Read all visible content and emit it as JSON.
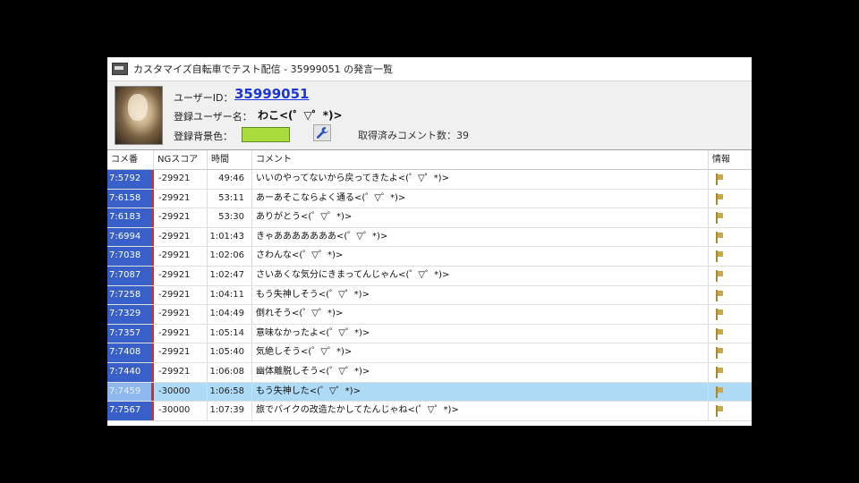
{
  "window": {
    "title": "カスタマイズ自転車でテスト配信 - 35999051 の発言一覧"
  },
  "user": {
    "id_label": "ユーザーID：",
    "id_value": "35999051",
    "name_label": "登録ユーザー名：",
    "name_value": "わこ<(゜▽゜*)>",
    "bg_label": "登録背景色：",
    "bg_color": "#a8dc3c",
    "count_label": "取得済みコメント数：",
    "count_value": "39"
  },
  "table": {
    "headers": [
      "コメ番",
      "NGスコア",
      "時間",
      "コメント",
      "情報"
    ],
    "rows": [
      {
        "no": "7:5792",
        "ng": "-29921",
        "time": "49:46",
        "comment": "いいのやってないから戻ってきたよ<(゜▽゜*)>"
      },
      {
        "no": "7:6158",
        "ng": "-29921",
        "time": "53:11",
        "comment": "あーあそこならよく通る<(゜▽゜*)>"
      },
      {
        "no": "7:6183",
        "ng": "-29921",
        "time": "53:30",
        "comment": "ありがとう<(゜▽゜*)>"
      },
      {
        "no": "7:6994",
        "ng": "-29921",
        "time": "1:01:43",
        "comment": "きゃあああああああ<(゜▽゜*)>"
      },
      {
        "no": "7:7038",
        "ng": "-29921",
        "time": "1:02:06",
        "comment": "さわんな<(゜▽゜*)>"
      },
      {
        "no": "7:7087",
        "ng": "-29921",
        "time": "1:02:47",
        "comment": "さいあくな気分にきまってんじゃん<(゜▽゜*)>"
      },
      {
        "no": "7:7258",
        "ng": "-29921",
        "time": "1:04:11",
        "comment": "もう失神しそう<(゜▽゜*)>"
      },
      {
        "no": "7:7329",
        "ng": "-29921",
        "time": "1:04:49",
        "comment": "倒れそう<(゜▽゜*)>"
      },
      {
        "no": "7:7357",
        "ng": "-29921",
        "time": "1:05:14",
        "comment": "意味なかったよ<(゜▽゜*)>"
      },
      {
        "no": "7:7408",
        "ng": "-29921",
        "time": "1:05:40",
        "comment": "気絶しそう<(゜▽゜*)>"
      },
      {
        "no": "7:7440",
        "ng": "-29921",
        "time": "1:06:08",
        "comment": "幽体離脱しそう<(゜▽゜*)>"
      },
      {
        "no": "7:7459",
        "ng": "-30000",
        "time": "1:06:58",
        "comment": "もう失神した<(゜▽゜*)>",
        "selected": true
      },
      {
        "no": "7:7567",
        "ng": "-30000",
        "time": "1:07:39",
        "comment": "旅でバイクの改造たかしてたんじゃね<(゜▽゜*)>"
      }
    ]
  }
}
